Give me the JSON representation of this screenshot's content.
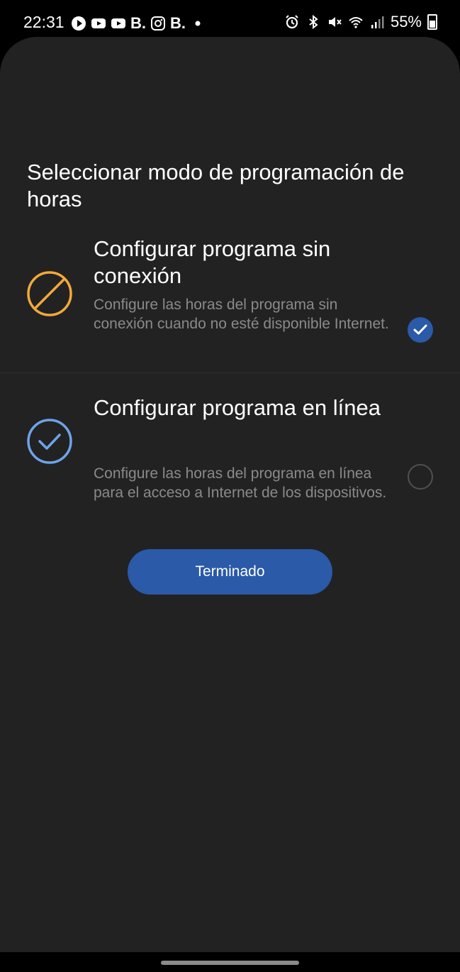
{
  "status_bar": {
    "time": "22:31",
    "left_icons": [
      "play-icon",
      "youtube-icon",
      "youtube-icon",
      "booking-b",
      "instagram-icon",
      "booking-b",
      "dot-icon"
    ],
    "booking_letter": "B.",
    "right_icons": [
      "alarm-icon",
      "bluetooth-icon",
      "mute-icon",
      "wifi-icon",
      "signal-icon",
      "battery-icon"
    ],
    "battery_percent": "55%"
  },
  "sheet": {
    "title": "Seleccionar modo de programación de horas",
    "options": [
      {
        "title": "Configurar programa sin conexión",
        "description": "Configure las horas del programa sin conexión cuando no esté disponible Internet.",
        "icon": "offline-block-icon",
        "icon_color": "#f2a93b",
        "selected": true
      },
      {
        "title": "Configurar programa en línea",
        "description": "Configure las horas del programa en línea para el acceso a Internet de los dispositivos.",
        "icon": "online-check-icon",
        "icon_color": "#6ea3e8",
        "selected": false
      }
    ],
    "done_button": "Terminado"
  },
  "colors": {
    "accent": "#2a5aa8",
    "background": "#222222",
    "secondary_text": "#8a8a8a"
  }
}
